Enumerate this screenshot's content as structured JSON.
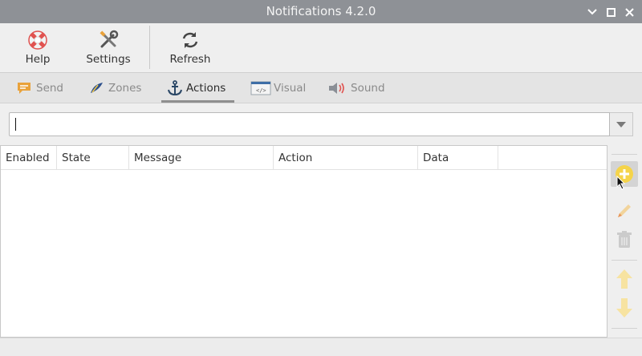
{
  "window": {
    "title": "Notifications 4.2.0"
  },
  "toolbar": {
    "help_label": "Help",
    "settings_label": "Settings",
    "refresh_label": "Refresh"
  },
  "tabs": [
    {
      "label": "Send",
      "icon": "send-icon"
    },
    {
      "label": "Zones",
      "icon": "zones-icon"
    },
    {
      "label": "Actions",
      "icon": "anchor-icon",
      "active": true
    },
    {
      "label": "Visual",
      "icon": "visual-icon"
    },
    {
      "label": "Sound",
      "icon": "speaker-icon"
    }
  ],
  "combo": {
    "value": ""
  },
  "table": {
    "columns": [
      "Enabled",
      "State",
      "Message",
      "Action",
      "Data"
    ],
    "rows": []
  },
  "side_buttons": [
    "add-icon",
    "edit-icon",
    "trash-icon",
    "arrow-up-icon",
    "arrow-down-icon"
  ],
  "colors": {
    "titlebar": "#8e9196",
    "accent_yellow": "#f5d44a"
  }
}
